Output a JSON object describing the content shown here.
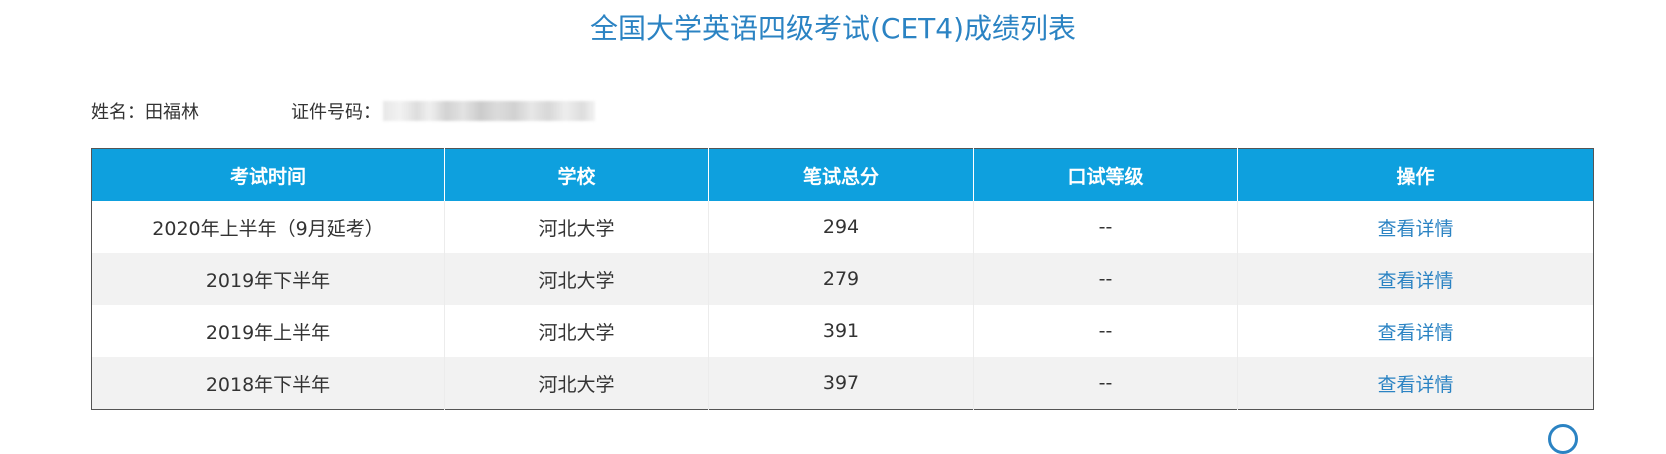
{
  "page": {
    "title": "全国大学英语四级考试(CET4)成绩列表"
  },
  "info": {
    "name_label": "姓名：",
    "name_value": "田福林",
    "id_label": "证件号码："
  },
  "table": {
    "headers": [
      "考试时间",
      "学校",
      "笔试总分",
      "口试等级",
      "操作"
    ],
    "rows": [
      {
        "time": "2020年上半年（9月延考）",
        "school": "河北大学",
        "score": "294",
        "oral": "--",
        "action": "查看详情"
      },
      {
        "time": "2019年下半年",
        "school": "河北大学",
        "score": "279",
        "oral": "--",
        "action": "查看详情"
      },
      {
        "time": "2019年上半年",
        "school": "河北大学",
        "score": "391",
        "oral": "--",
        "action": "查看详情"
      },
      {
        "time": "2018年下半年",
        "school": "河北大学",
        "score": "397",
        "oral": "--",
        "action": "查看详情"
      }
    ]
  },
  "colors": {
    "title": "#2b83c3",
    "header_bg": "#0ea0de",
    "link": "#2b83c3",
    "alt_row_bg": "#f2f2f2"
  }
}
